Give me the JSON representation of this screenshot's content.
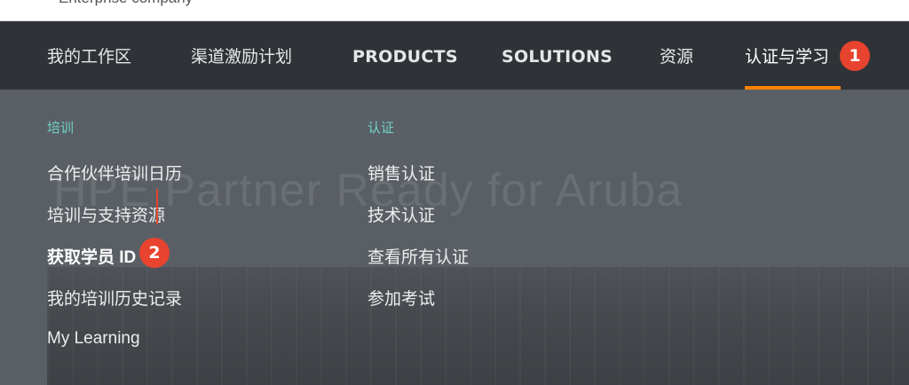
{
  "header": {
    "company_text": "Enterprise company"
  },
  "nav": {
    "items": [
      {
        "label": "我的工作区"
      },
      {
        "label": "渠道激励计划"
      },
      {
        "label": "PRODUCTS"
      },
      {
        "label": "SOLUTIONS"
      },
      {
        "label": "资源"
      },
      {
        "label": "认证与学习"
      }
    ],
    "active_index": 5,
    "accent_color": "#ff8300"
  },
  "mega_menu": {
    "background_text": "HPE Partner Ready for Aruba",
    "training": {
      "heading": "培训",
      "links": [
        "合作伙伴培训日历",
        "培训与支持资源",
        "获取学员 ID",
        "我的培训历史记录",
        "My Learning"
      ]
    },
    "certification": {
      "heading": "认证",
      "links": [
        "销售认证",
        "技术认证",
        "查看所有认证",
        "参加考试"
      ]
    }
  },
  "annotations": {
    "badge_1": "1",
    "badge_2": "2",
    "color": "#e8432e"
  }
}
